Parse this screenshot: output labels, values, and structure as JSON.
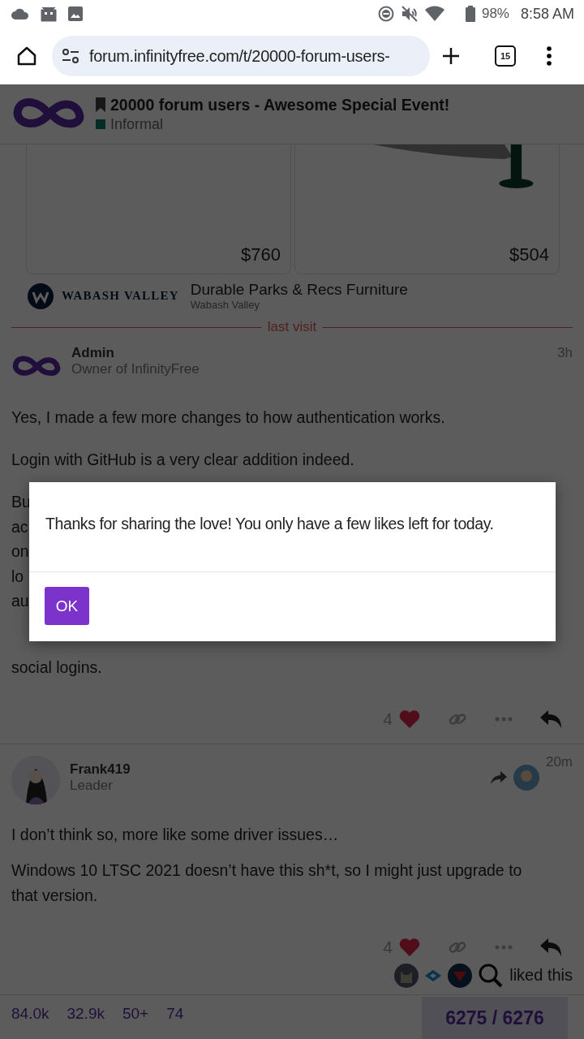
{
  "status_bar": {
    "battery": "98%",
    "time": "8:58 AM"
  },
  "browser": {
    "url": "forum.infinityfree.com/t/20000-forum-users-",
    "tab_count": "15"
  },
  "topic": {
    "title": "20000 forum users - Awesome Special Event!",
    "category": "Informal"
  },
  "ad": {
    "prices": [
      "$760",
      "$504"
    ],
    "brand": "WABASH VALLEY",
    "headline": "Durable Parks & Recs Furniture",
    "advertiser": "Wabash Valley"
  },
  "last_visit": "last visit",
  "posts": [
    {
      "kind": "staff",
      "name": "Admin",
      "title": "Owner of InfinityFree",
      "time": "3h",
      "reply_to": false,
      "paragraphs": [
        "Yes, I made a few more changes to how authentication works.",
        "Login with GitHub is a very clear addition indeed."
      ],
      "covered_lines": [
        "Bu",
        "ac",
        "on",
        "lo",
        "au"
      ],
      "after": [
        "social logins."
      ],
      "likes": "4",
      "liked": true
    },
    {
      "kind": "member",
      "name": "Frank419",
      "title": "Leader",
      "time": "20m",
      "reply_to": true,
      "paragraphs": [
        "I don’t think so, more like some driver issues…",
        "Windows 10 LTSC 2021 doesn’t have this sh*t, so I might just upgrade to that version."
      ],
      "likes": "4",
      "liked": true,
      "liked_by": "liked this"
    }
  ],
  "stats": [
    "84.0k",
    "32.9k",
    "50+",
    "74"
  ],
  "progress": "6275 / 6276",
  "dialog": {
    "message": "Thanks for sharing the love! You only have a few likes left for today.",
    "button": "OK"
  }
}
